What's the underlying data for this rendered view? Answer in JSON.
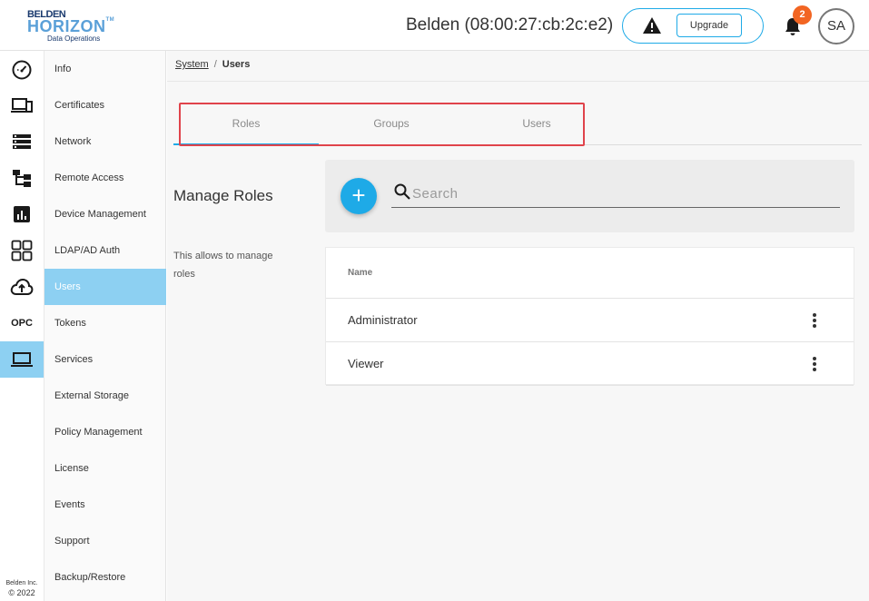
{
  "header": {
    "logo": {
      "line1": "BELDEN",
      "line2": "HORIZON",
      "trademark": "TM",
      "line3": "Data Operations"
    },
    "device_name": "Belden (08:00:27:cb:2c:e2)",
    "upgrade_label": "Upgrade",
    "notification_count": "2",
    "avatar_initials": "SA"
  },
  "rail": {
    "items": [
      {
        "icon": "dashboard-gauge-icon"
      },
      {
        "icon": "devices-icon"
      },
      {
        "icon": "list-icon"
      },
      {
        "icon": "hierarchy-icon"
      },
      {
        "icon": "chart-icon"
      },
      {
        "icon": "apps-grid-icon"
      },
      {
        "icon": "cloud-upload-icon"
      },
      {
        "icon": "opc-icon",
        "label": "OPC"
      },
      {
        "icon": "laptop-icon",
        "active": true
      }
    ],
    "footer": {
      "company": "Belden Inc.",
      "copyright": "© 2022"
    }
  },
  "subnav": {
    "items": [
      {
        "label": "Info"
      },
      {
        "label": "Certificates"
      },
      {
        "label": "Network"
      },
      {
        "label": "Remote Access"
      },
      {
        "label": "Device Management"
      },
      {
        "label": "LDAP/AD Auth"
      },
      {
        "label": "Users",
        "active": true
      },
      {
        "label": "Tokens"
      },
      {
        "label": "Services"
      },
      {
        "label": "External Storage"
      },
      {
        "label": "Policy Management"
      },
      {
        "label": "License"
      },
      {
        "label": "Events"
      },
      {
        "label": "Support"
      },
      {
        "label": "Backup/Restore"
      }
    ]
  },
  "breadcrumb": {
    "parent": "System",
    "separator": "/",
    "current": "Users"
  },
  "tabs": [
    {
      "label": "Roles",
      "active": true
    },
    {
      "label": "Groups"
    },
    {
      "label": "Users"
    }
  ],
  "manage": {
    "title": "Manage Roles",
    "description": "This allows to manage roles"
  },
  "toolbar": {
    "add_label": "+",
    "search_placeholder": "Search"
  },
  "table": {
    "columns": [
      "Name"
    ],
    "rows": [
      {
        "name": "Administrator"
      },
      {
        "name": "Viewer"
      }
    ]
  },
  "colors": {
    "accent": "#1eaae7",
    "active_nav": "#8dd0f2",
    "badge": "#f26522",
    "highlight": "#e0434b"
  }
}
